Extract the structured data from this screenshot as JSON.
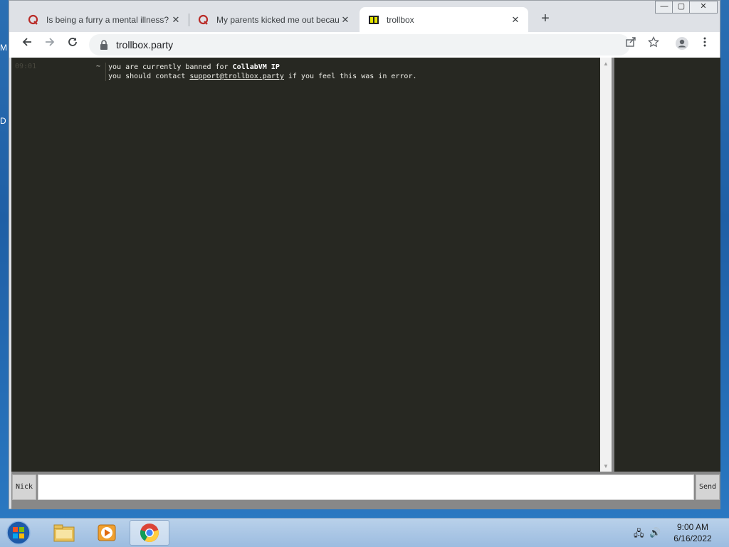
{
  "desktop": {
    "edge_letters": [
      "M",
      "D"
    ]
  },
  "browser": {
    "tabs": [
      {
        "title": "Is being a furry a mental illness?",
        "favicon": "quora-icon",
        "close": "✕",
        "active": false
      },
      {
        "title": "My parents kicked me out becau",
        "favicon": "quora-icon",
        "close": "✕",
        "active": false
      },
      {
        "title": "trollbox",
        "favicon": "trollbox-icon",
        "close": "✕",
        "active": true
      }
    ],
    "new_tab": "+",
    "window_controls": {
      "minimize": "—",
      "maximize": "▢",
      "close": "✕"
    },
    "address": {
      "url": "trollbox.party"
    }
  },
  "chat": {
    "messages": [
      {
        "time": "09:01",
        "nick": "~",
        "line1_prefix": "you are currently banned for ",
        "line1_reason": "CollabVM IP",
        "line2_prefix": "you should contact ",
        "line2_email": "support@trollbox.party",
        "line2_suffix": " if you feel this was in error."
      }
    ],
    "nick_button": "Nick",
    "send_button": "Send",
    "input_value": ""
  },
  "taskbar": {
    "clock_time": "9:00 AM",
    "clock_date": "6/16/2022"
  },
  "colors": {
    "chat_bg": "#272822",
    "accent_quora": "#b92b27"
  }
}
